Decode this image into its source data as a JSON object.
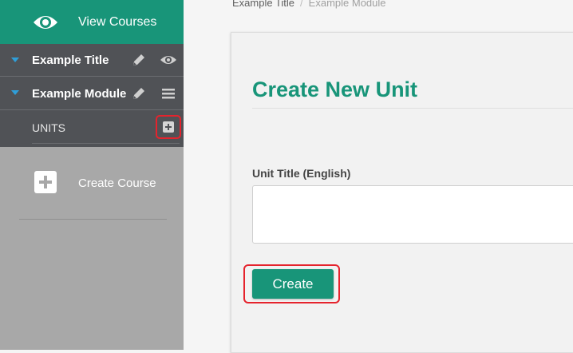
{
  "sidebar": {
    "view_courses": {
      "label": "View Courses",
      "icon": "eye-icon"
    },
    "course": {
      "title": "Example Title",
      "icons": [
        "pencil-icon",
        "eye-icon"
      ]
    },
    "module": {
      "title": "Example Module",
      "icons": [
        "pencil-icon",
        "hamburger-menu-icon"
      ]
    },
    "units": {
      "label": "UNITS",
      "add_icon": "plus-square-icon"
    },
    "create_course": {
      "label": "Create Course",
      "icon": "plus-square-icon"
    }
  },
  "breadcrumb": {
    "items": [
      "Example Title",
      "Example Module"
    ],
    "separator": "/"
  },
  "form": {
    "title": "Create New Unit",
    "unit_title_label": "Unit Title (English)",
    "unit_title_value": "",
    "submit_label": "Create"
  },
  "colors": {
    "brand_green": "#189579",
    "sidebar_dark": "#505256",
    "sidebar_light": "#a8a8a8",
    "highlight_red": "#e5232d",
    "caret_blue": "#2f9ed8"
  }
}
